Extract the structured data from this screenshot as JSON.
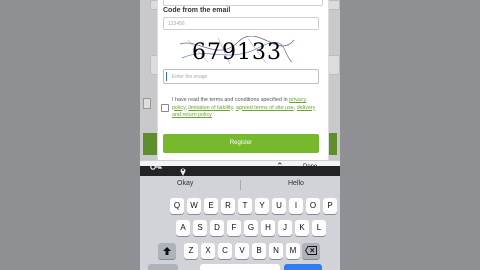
{
  "form": {
    "code_label": "Code from the email",
    "code_placeholder": "123456",
    "captcha_text": "679133",
    "captcha_placeholder": "Enter the image",
    "terms_prefix": "I have read the terms and conditions specified in",
    "terms_links": [
      "privacy policy",
      "limitation of liability",
      "agreed terms of site use",
      "delivery and return policy"
    ],
    "register_label": "Register"
  },
  "toolbar": {
    "done_label": "Done",
    "key_icon": "key-icon",
    "location_icon": "location-icon"
  },
  "keyboard": {
    "suggestions": [
      "Okay",
      "Hello"
    ],
    "row1": [
      "Q",
      "W",
      "E",
      "R",
      "T",
      "Y",
      "U",
      "I",
      "O",
      "P"
    ],
    "row2": [
      "A",
      "S",
      "D",
      "F",
      "G",
      "H",
      "J",
      "K",
      "L"
    ],
    "row3": [
      "Z",
      "X",
      "C",
      "V",
      "B",
      "N",
      "M"
    ],
    "shift_icon": "shift-icon",
    "backspace_icon": "backspace-icon"
  },
  "colors": {
    "accent_green": "#77b82f",
    "link_green": "#6aa32f",
    "keyboard_bg": "#d1d3d8"
  }
}
